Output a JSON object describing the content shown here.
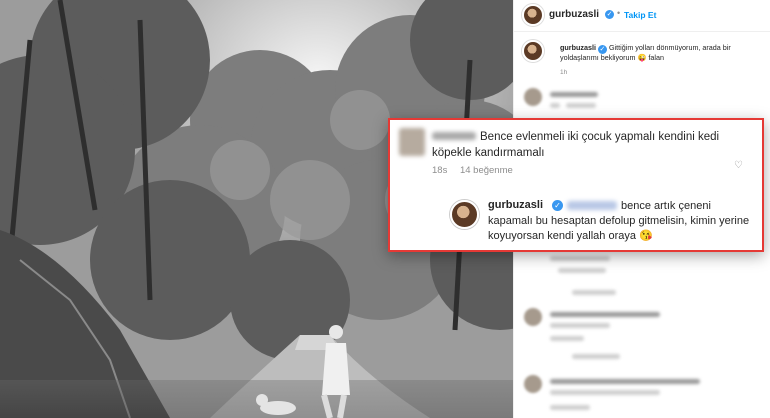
{
  "post": {
    "username": "gurbuzasli",
    "verified_badge": "✓",
    "follow_label": "Takip Et",
    "separator": "•",
    "caption_text": "Gittiğim yolları dönmüyorum, arada bir yoldaşlarımı bekliyorum 😜 falan",
    "caption_time": "1h"
  },
  "highlighted_comment": {
    "text": "Bence evlenmeli iki çocuk yapmalı kendini kedi köpekle kandırmamalı",
    "time": "18s",
    "likes": "14 beğenme",
    "heart_icon": "♡"
  },
  "highlighted_reply": {
    "username": "gurbuzasli",
    "verified_badge": "✓",
    "text": "bence artık çeneni kapamalı bu hesaptan defolup gitmelisin, kimin yerine koyuyorsan kendi yallah oraya 😘"
  },
  "colors": {
    "accent": "#0095f6",
    "verified": "#3897f0",
    "highlight_border": "#e53935"
  }
}
